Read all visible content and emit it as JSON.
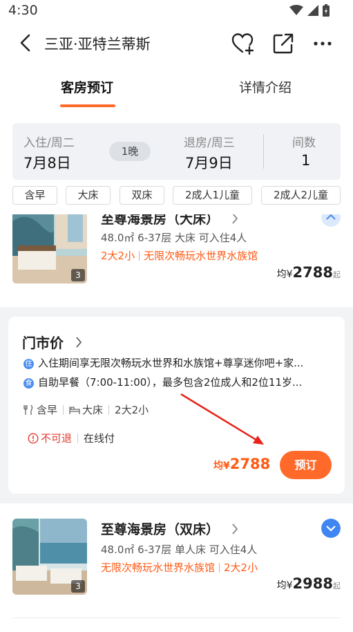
{
  "status": {
    "time": "4:30"
  },
  "nav": {
    "title": "三亚·亚特兰蒂斯"
  },
  "tabs": [
    {
      "label": "客房预订"
    },
    {
      "label": "详情介绍"
    }
  ],
  "dates": {
    "checkin_label": "入住/周二",
    "checkin_value": "7月8日",
    "nights": "1晚",
    "checkout_label": "退房/周三",
    "checkout_value": "7月9日",
    "rooms_label": "间数",
    "rooms_value": "1"
  },
  "filters": [
    "含早",
    "大床",
    "双床",
    "2成人1儿童",
    "2成人2儿童"
  ],
  "rooms": [
    {
      "name": "至尊海景房（大床）",
      "info": "48.0㎡ 6-37层 大床 可入住4人",
      "tag1": "2大2小",
      "tag2": "无限次畅玩水世界水族馆",
      "photo_count": "3",
      "price_prefix": "均¥",
      "price": "2788",
      "price_suffix": "起"
    },
    {
      "name": "至尊海景房（双床）",
      "info": "48.0㎡ 6-37层 单人床 可入住4人",
      "tag1": "无限次畅玩水世界水族馆",
      "tag2": "2大2小",
      "photo_count": "3",
      "price_prefix": "均¥",
      "price": "2988",
      "price_suffix": "起"
    }
  ],
  "offer": {
    "title": "门市价",
    "line1_badge": "住",
    "line1": "入住期间享无限次畅玩水世界和水族馆+尊享迷你吧+家...",
    "line2_badge": "食",
    "line2": "自助早餐（7:00-11:00），最多包含2位成人和2位11岁...",
    "feat_breakfast": "含早",
    "feat_bed": "大床",
    "feat_guests": "2大2小",
    "policy_cancel": "不可退",
    "policy_pay": "在线付",
    "price_prefix": "均¥",
    "price": "2788",
    "book_label": "预订"
  },
  "colors": {
    "accent": "#ff6a2b",
    "price": "#ff5a14",
    "link_blue": "#4d8ff0",
    "warn_red": "#e23a2e"
  }
}
